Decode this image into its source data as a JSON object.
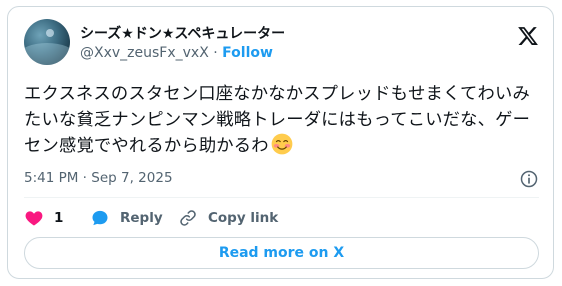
{
  "user": {
    "display_name": "シーズ★ドン★スペキュレーター",
    "handle": "@Xxv_zeusFx_vxX",
    "separator": "·",
    "follow_label": "Follow"
  },
  "tweet": {
    "text": "エクスネスのスタセン口座なかなかスプレッドもせまくてわいみたいな貧乏ナンピンマン戦略トレーダにはもってこいだな、ゲーセン感覚でやれるから助かるわ",
    "emoji": "smiling-face-with-blush-icon",
    "timestamp": "5:41 PM · Sep 7, 2025"
  },
  "actions": {
    "like_count": "1",
    "reply_label": "Reply",
    "copy_link_label": "Copy link"
  },
  "read_more_label": "Read more on X",
  "colors": {
    "accent": "#1d9bf0",
    "like": "#f91880",
    "muted": "#536471",
    "border": "#cfd9de"
  }
}
